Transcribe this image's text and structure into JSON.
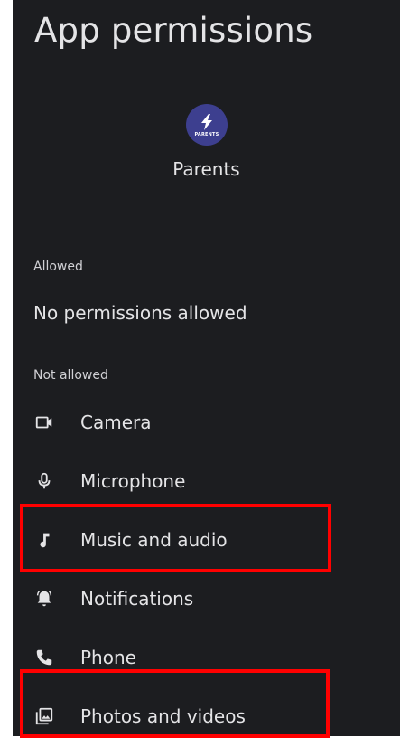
{
  "header": {
    "title": "App permissions"
  },
  "app": {
    "name": "Parents",
    "icon_text": "PARENTS",
    "icon_color": "#3d3f8f"
  },
  "sections": {
    "allowed": {
      "label": "Allowed",
      "empty_text": "No permissions allowed"
    },
    "not_allowed": {
      "label": "Not allowed",
      "items": [
        {
          "label": "Camera",
          "icon": "camera-icon"
        },
        {
          "label": "Microphone",
          "icon": "microphone-icon"
        },
        {
          "label": "Music and audio",
          "icon": "music-note-icon",
          "highlighted": true
        },
        {
          "label": "Notifications",
          "icon": "bell-icon"
        },
        {
          "label": "Phone",
          "icon": "phone-icon"
        },
        {
          "label": "Photos and videos",
          "icon": "photo-library-icon",
          "highlighted": true
        }
      ]
    }
  },
  "colors": {
    "background": "#1c1d20",
    "text": "#e4e4e6",
    "highlight": "#ff0000"
  }
}
